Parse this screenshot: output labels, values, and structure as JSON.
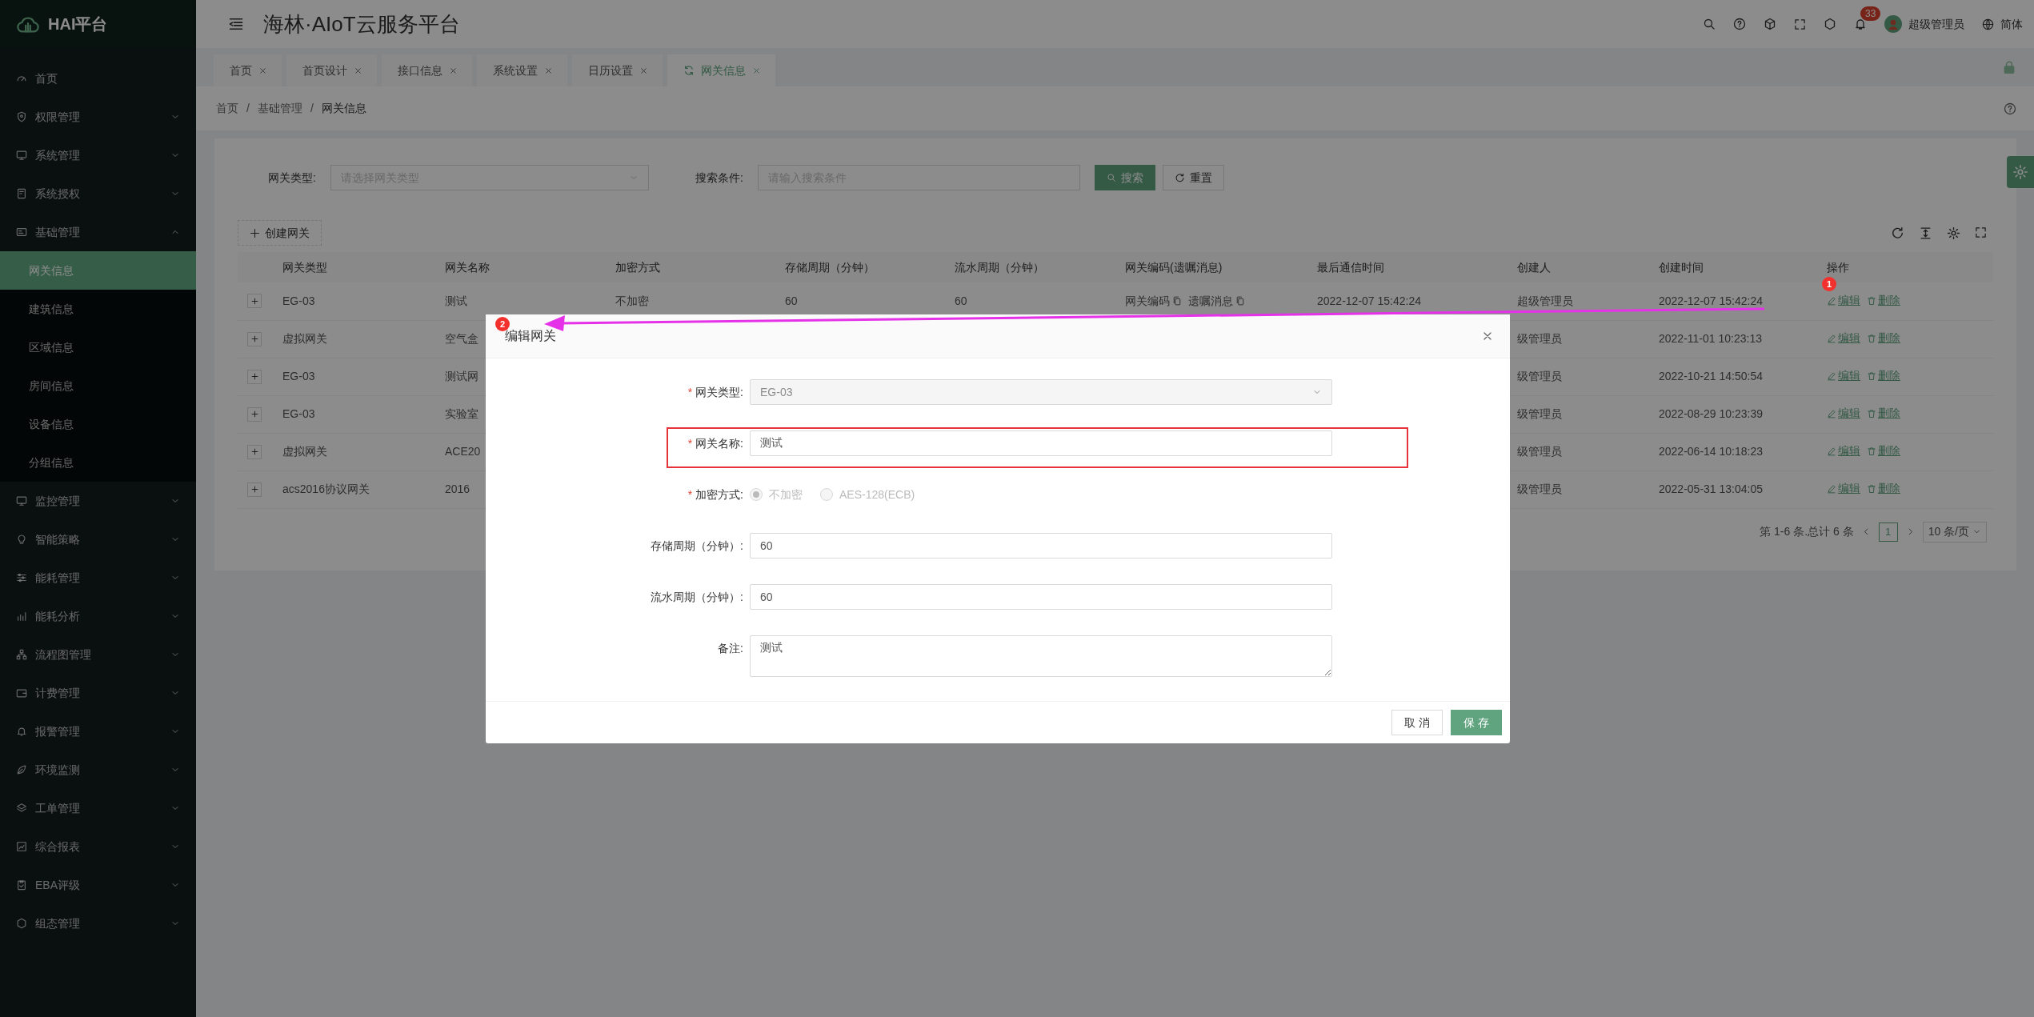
{
  "brand": {
    "name": "HAI平台"
  },
  "header": {
    "title": "海林·AIoT云服务平台",
    "notification_count": "33",
    "user": "超级管理员",
    "language": "简体"
  },
  "sidebar": {
    "items": [
      {
        "label": "首页",
        "kind": "link"
      },
      {
        "label": "权限管理",
        "kind": "group",
        "expanded": false
      },
      {
        "label": "系统管理",
        "kind": "group",
        "expanded": false
      },
      {
        "label": "系统授权",
        "kind": "group",
        "expanded": false
      },
      {
        "label": "基础管理",
        "kind": "group",
        "expanded": true,
        "children": [
          {
            "label": "网关信息",
            "selected": true
          },
          {
            "label": "建筑信息",
            "selected": false
          },
          {
            "label": "区域信息",
            "selected": false
          },
          {
            "label": "房间信息",
            "selected": false
          },
          {
            "label": "设备信息",
            "selected": false
          },
          {
            "label": "分组信息",
            "selected": false
          }
        ]
      },
      {
        "label": "监控管理",
        "kind": "group",
        "expanded": false
      },
      {
        "label": "智能策略",
        "kind": "group",
        "expanded": false
      },
      {
        "label": "能耗管理",
        "kind": "group",
        "expanded": false
      },
      {
        "label": "能耗分析",
        "kind": "group",
        "expanded": false
      },
      {
        "label": "流程图管理",
        "kind": "group",
        "expanded": false
      },
      {
        "label": "计费管理",
        "kind": "group",
        "expanded": false
      },
      {
        "label": "报警管理",
        "kind": "group",
        "expanded": false
      },
      {
        "label": "环境监测",
        "kind": "group",
        "expanded": false
      },
      {
        "label": "工单管理",
        "kind": "group",
        "expanded": false
      },
      {
        "label": "综合报表",
        "kind": "group",
        "expanded": false
      },
      {
        "label": "EBA评级",
        "kind": "group",
        "expanded": false
      },
      {
        "label": "组态管理",
        "kind": "group",
        "expanded": false
      }
    ]
  },
  "tabs": [
    {
      "label": "首页",
      "selected": false
    },
    {
      "label": "首页设计",
      "selected": false
    },
    {
      "label": "接口信息",
      "selected": false
    },
    {
      "label": "系统设置",
      "selected": false
    },
    {
      "label": "日历设置",
      "selected": false
    },
    {
      "label": "网关信息",
      "selected": true
    }
  ],
  "breadcrumb": {
    "items": [
      "首页",
      "基础管理",
      "网关信息"
    ],
    "separator": "/"
  },
  "filters": [
    {
      "label": "网关类型:",
      "kind": "select",
      "placeholder": "请选择网关类型"
    },
    {
      "label": "搜索条件:",
      "kind": "input",
      "placeholder": "请输入搜索条件"
    }
  ],
  "search_button": "搜索",
  "reset_button": "重置",
  "create_button": "创建网关",
  "table": {
    "columns": [
      "网关类型",
      "网关名称",
      "加密方式",
      "存储周期（分钟）",
      "流水周期（分钟）",
      "网关编码(遗嘱消息)",
      "最后通信时间",
      "创建人",
      "创建时间",
      "操作"
    ],
    "rows": [
      {
        "type": "EG-03",
        "name": "测试",
        "encryption": "不加密",
        "storage_period": "60",
        "flow_period": "60",
        "code_links": [
          "网关编码",
          "遗嘱消息"
        ],
        "last_comm": "2022-12-07 15:42:24",
        "creator": "超级管理员",
        "created": "2022-12-07 15:42:24",
        "actions": [
          "编辑",
          "删除"
        ]
      },
      {
        "type": "虚拟网关",
        "name": "空气盒",
        "creator": "级管理员",
        "created": "2022-11-01 10:23:13",
        "actions": [
          "编辑",
          "删除"
        ]
      },
      {
        "type": "EG-03",
        "name": "测试网",
        "creator": "级管理员",
        "created": "2022-10-21 14:50:54",
        "actions": [
          "编辑",
          "删除"
        ]
      },
      {
        "type": "EG-03",
        "name": "实验室",
        "creator": "级管理员",
        "created": "2022-08-29 10:23:39",
        "actions": [
          "编辑",
          "删除"
        ]
      },
      {
        "type": "虚拟网关",
        "name": "ACE20",
        "creator": "级管理员",
        "created": "2022-06-14 10:18:23",
        "actions": [
          "编辑",
          "删除"
        ]
      },
      {
        "type": "acs2016协议网关",
        "name": "2016",
        "creator": "级管理员",
        "created": "2022-05-31 13:04:05",
        "actions": [
          "编辑",
          "删除"
        ]
      }
    ]
  },
  "pagination": {
    "summary": "第 1-6 条.总计 6 条",
    "pages": [
      {
        "label": "1",
        "selected": true
      }
    ],
    "page_size": "10 条/页"
  },
  "modal": {
    "title": "编辑网关",
    "fields": [
      {
        "kind": "select",
        "mark": "*",
        "label": "网关类型:",
        "value": "EG-03",
        "disabled": true
      },
      {
        "kind": "input",
        "mark": "*",
        "label": "网关名称:",
        "value": "测试",
        "disabled": false
      },
      {
        "kind": "radio",
        "mark": "*",
        "label": "加密方式:",
        "disabled": true,
        "options": [
          {
            "label": "不加密",
            "checked": true
          },
          {
            "label": "AES-128(ECB)",
            "checked": false
          }
        ]
      },
      {
        "kind": "input",
        "label": "存储周期（分钟）:",
        "value": "60",
        "disabled": false
      },
      {
        "kind": "input",
        "label": "流水周期（分钟）:",
        "value": "60",
        "disabled": false
      },
      {
        "kind": "textarea",
        "label": "备注:",
        "value": "测试",
        "disabled": false
      }
    ],
    "buttons": [
      {
        "label": "取 消",
        "kind": "default"
      },
      {
        "label": "保 存",
        "kind": "primary"
      }
    ]
  },
  "annotations": [
    {
      "label": "1"
    },
    {
      "label": "2"
    }
  ]
}
